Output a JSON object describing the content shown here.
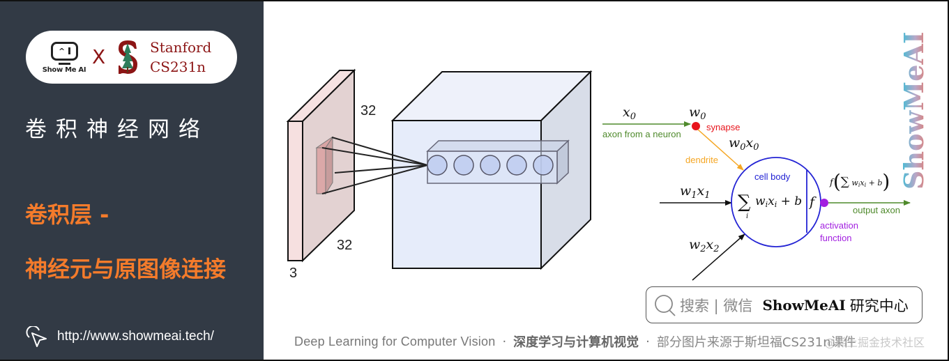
{
  "sidebar": {
    "logo": {
      "showmeai_label": "Show Me AI",
      "showmeai_eyes": "^",
      "cross": "X",
      "stanford_line1": "Stanford",
      "stanford_line2": "CS231n"
    },
    "course_title": "卷积神经网络",
    "section_title_line1": "卷积层 -",
    "section_title_line2": "神经元与原图像连接",
    "url": "http://www.showmeai.tech/"
  },
  "diagram": {
    "left_figure": {
      "input_height_label": "32",
      "input_width_label": "32",
      "input_depth_label": "3",
      "neuron_count": 5
    },
    "neuron_model": {
      "x0": "x0",
      "w0": "w0",
      "w0x0": "w0x0",
      "w1x1": "w1x1",
      "w2x2": "w2x2",
      "axon_label": "axon from a neuron",
      "synapse_label": "synapse",
      "dendrite_label": "dendrite",
      "cell_body_label": "cell body",
      "sum_formula": "∑ wᵢxᵢ + b",
      "sum_index": "i",
      "f_label": "f",
      "output_formula": "f(∑ wᵢxᵢ + b)",
      "output_axon_label": "output axon",
      "activation_label_line1": "activation",
      "activation_label_line2": "function"
    },
    "colors": {
      "axon_green": "#4f8a2c",
      "synapse_red": "#e8141c",
      "dendrite_orange": "#f5a623",
      "cell_blue": "#2323d4",
      "activation_purple": "#a21fe0"
    }
  },
  "vertical_brand": "ShowMeAI",
  "search_box": {
    "hint": "搜索 | 微信",
    "brand": "ShowMeAI",
    "suffix": "研究中心"
  },
  "footer": {
    "english": "Deep Learning for Computer Vision",
    "separator": "·",
    "chinese_bold": "深度学习与计算机视觉",
    "source_note": "部分图片来源于斯坦福CS231n课件"
  },
  "watermark": "@稀土掘金技术社区",
  "theme": {
    "sidebar_bg": "#323a45",
    "accent_orange": "#f47b2b",
    "stanford_red": "#8c1515"
  }
}
